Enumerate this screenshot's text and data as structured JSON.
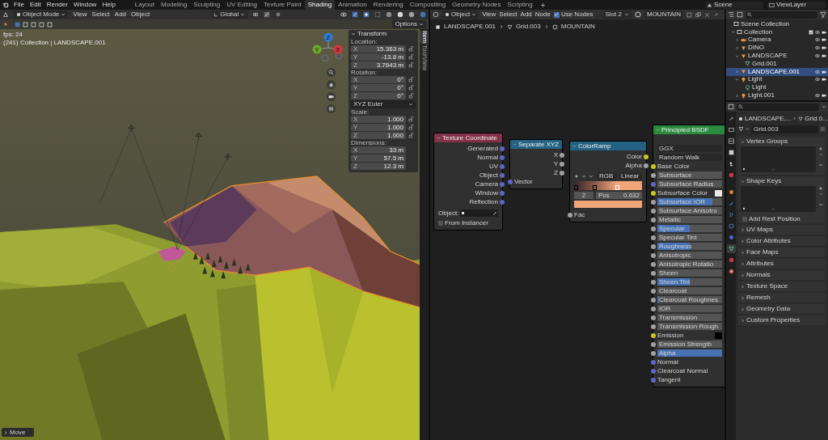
{
  "topbar": {
    "menus": [
      "File",
      "Edit",
      "Render",
      "Window",
      "Help"
    ],
    "workspaces": [
      {
        "label": "Layout",
        "selected": false
      },
      {
        "label": "Modeling",
        "selected": false
      },
      {
        "label": "Sculpting",
        "selected": false
      },
      {
        "label": "UV Editing",
        "selected": false
      },
      {
        "label": "Texture Paint",
        "selected": false
      },
      {
        "label": "Shading",
        "selected": true
      },
      {
        "label": "Animation",
        "selected": false
      },
      {
        "label": "Rendering",
        "selected": false
      },
      {
        "label": "Compositing",
        "selected": false
      },
      {
        "label": "Geometry Nodes",
        "selected": false
      },
      {
        "label": "Scripting",
        "selected": false
      }
    ],
    "scene": "Scene",
    "view_layer": "ViewLayer"
  },
  "viewport": {
    "header": {
      "mode": "Object Mode",
      "menus": [
        "View",
        "Select",
        "Add",
        "Object"
      ],
      "orientation": "Global"
    },
    "options": "Options",
    "stats": [
      "fps: 24",
      "(241) Collection | LANDSCAPE.001"
    ],
    "gizmo": [
      {
        "label": "Z",
        "color": "#2f7dd8"
      },
      {
        "label": "Y",
        "color": "#6fa82a"
      },
      {
        "label": "X",
        "color": "#d8343f"
      }
    ],
    "transform": {
      "title": "Transform",
      "groups": [
        {
          "label": "Location:",
          "lockable": true,
          "fields": [
            {
              "axis": "X",
              "value": "15.363 m"
            },
            {
              "axis": "Y",
              "value": "-13.8 m"
            },
            {
              "axis": "Z",
              "value": "3.7643 m"
            }
          ]
        },
        {
          "label": "Rotation:",
          "lockable": true,
          "fields": [
            {
              "axis": "X",
              "value": "0°"
            },
            {
              "axis": "Y",
              "value": "0°"
            },
            {
              "axis": "Z",
              "value": "0°"
            }
          ],
          "mode": "XYZ Euler"
        },
        {
          "label": "Scale:",
          "lockable": true,
          "fields": [
            {
              "axis": "X",
              "value": "1.000"
            },
            {
              "axis": "Y",
              "value": "1.000"
            },
            {
              "axis": "Z",
              "value": "1.000"
            }
          ]
        },
        {
          "label": "Dimensions:",
          "lockable": false,
          "fields": [
            {
              "axis": "X",
              "value": "33 m"
            },
            {
              "axis": "Y",
              "value": "57.5 m"
            },
            {
              "axis": "Z",
              "value": "12.3 m"
            }
          ]
        }
      ]
    },
    "sidebar_tabs": [
      {
        "label": "Item",
        "selected": true
      },
      {
        "label": "Tool",
        "selected": false
      },
      {
        "label": "View",
        "selected": false
      }
    ],
    "last_operator": "Move"
  },
  "node_editor": {
    "header": {
      "context": "Object",
      "menus": [
        "View",
        "Select",
        "Add",
        "Node"
      ],
      "use_nodes": {
        "label": "Use Nodes",
        "checked": true
      },
      "slot": "Slot 2",
      "material": "MOUNTAIN"
    },
    "breadcrumb": [
      "LANDSCAPE.001",
      "Grid.003",
      "MOUNTAIN"
    ],
    "nodes": [
      {
        "kind": "input",
        "title": "Texture Coordinate",
        "rows": [
          {
            "kind": "output",
            "label": "Generated",
            "socket": {
              "color": "#6363c7"
            }
          },
          {
            "kind": "output",
            "label": "Normal",
            "socket": {
              "color": "#6363c7"
            }
          },
          {
            "kind": "output",
            "label": "UV",
            "socket": {
              "color": "#6363c7"
            }
          },
          {
            "kind": "output",
            "label": "Object",
            "socket": {
              "color": "#6363c7"
            }
          },
          {
            "kind": "output",
            "label": "Camera",
            "socket": {
              "color": "#6363c7"
            }
          },
          {
            "kind": "output",
            "label": "Window",
            "socket": {
              "color": "#6363c7"
            }
          },
          {
            "kind": "output",
            "label": "Reflection",
            "socket": {
              "color": "#6363c7"
            }
          },
          {
            "kind": "object_field",
            "label": "Object:"
          },
          {
            "kind": "checkbox",
            "label": "From Instancer",
            "checked": false
          }
        ]
      },
      {
        "kind": "converter",
        "title": "Separate XYZ",
        "rows": [
          {
            "kind": "output",
            "label": "X",
            "socket": {
              "color": "#a1a1a1"
            }
          },
          {
            "kind": "output",
            "label": "Y",
            "socket": {
              "color": "#a1a1a1"
            }
          },
          {
            "kind": "output",
            "label": "Z",
            "socket": {
              "color": "#a1a1a1"
            }
          },
          {
            "kind": "input",
            "label": "Vector",
            "socket": {
              "color": "#6363c7"
            }
          }
        ]
      },
      {
        "kind": "converter",
        "title": "ColorRamp",
        "rows": [
          {
            "kind": "output",
            "label": "Color",
            "socket": {
              "color": "#c7c729"
            }
          },
          {
            "kind": "output",
            "label": "Alpha",
            "socket": {
              "color": "#a1a1a1"
            }
          },
          {
            "kind": "ramp",
            "color_mode": "RGB",
            "interpolation": "Linear",
            "stops": [
              {
                "level": 0.03,
                "color": "#3d2a2c",
                "selected": false
              },
              {
                "level": 0.3,
                "color": "#8c5a4a",
                "selected": false
              },
              {
                "level": 0.632,
                "color": "#f0a679",
                "selected": true
              }
            ],
            "index": "2",
            "pos_label": "Pos",
            "pos_value": "0.632",
            "color": "#f0a679"
          },
          {
            "kind": "input",
            "label": "Fac",
            "socket": {
              "color": "#a1a1a1"
            }
          }
        ]
      },
      {
        "kind": "shader",
        "title": "Principled BSDF",
        "rows": [
          {
            "kind": "dropdown",
            "label": "GGX"
          },
          {
            "kind": "dropdown",
            "label": "Random Walk"
          },
          {
            "kind": "input",
            "label": "Base Color",
            "socket": {
              "color": "#c7c729"
            }
          },
          {
            "kind": "slider",
            "label": "Subsurface",
            "socket": {
              "color": "#a1a1a1"
            },
            "level": 0
          },
          {
            "kind": "slider",
            "label": "Subsurface Radius",
            "socket": {
              "color": "#6363c7"
            },
            "level": 0
          },
          {
            "kind": "color_input",
            "label": "Subsurface Color",
            "socket": {
              "color": "#c7c729"
            },
            "color": "#e8e8e8"
          },
          {
            "kind": "slider",
            "label": "Subsurface IOR",
            "socket": {
              "color": "#a1a1a1"
            },
            "level": 0.85
          },
          {
            "kind": "slider",
            "label": "Subsurface Anisotro",
            "socket": {
              "color": "#a1a1a1"
            },
            "level": 0
          },
          {
            "kind": "slider",
            "label": "Metallic",
            "socket": {
              "color": "#a1a1a1"
            },
            "level": 0
          },
          {
            "kind": "slider",
            "label": "Specular",
            "socket": {
              "color": "#a1a1a1"
            },
            "level": 0.5
          },
          {
            "kind": "slider",
            "label": "Specular Tint",
            "socket": {
              "color": "#a1a1a1"
            },
            "level": 0
          },
          {
            "kind": "slider",
            "label": "Roughness",
            "socket": {
              "color": "#a1a1a1"
            },
            "level": 0.5
          },
          {
            "kind": "slider",
            "label": "Anisotropic",
            "socket": {
              "color": "#a1a1a1"
            },
            "level": 0
          },
          {
            "kind": "slider",
            "label": "Anisotropic Rotatio",
            "socket": {
              "color": "#a1a1a1"
            },
            "level": 0
          },
          {
            "kind": "slider",
            "label": "Sheen",
            "socket": {
              "color": "#a1a1a1"
            },
            "level": 0
          },
          {
            "kind": "slider",
            "label": "Sheen Tint",
            "socket": {
              "color": "#a1a1a1"
            },
            "level": 0.5
          },
          {
            "kind": "slider",
            "label": "Clearcoat",
            "socket": {
              "color": "#a1a1a1"
            },
            "level": 0
          },
          {
            "kind": "slider",
            "label": "Clearcoat Roughnes",
            "socket": {
              "color": "#a1a1a1"
            },
            "level": 0.03
          },
          {
            "kind": "slider",
            "label": "IOR",
            "socket": {
              "color": "#a1a1a1"
            },
            "level": 0
          },
          {
            "kind": "slider",
            "label": "Transmission",
            "socket": {
              "color": "#a1a1a1"
            },
            "level": 0
          },
          {
            "kind": "slider",
            "label": "Transmission Rough",
            "socket": {
              "color": "#a1a1a1"
            },
            "level": 0
          },
          {
            "kind": "color_input",
            "label": "Emission",
            "socket": {
              "color": "#c7c729"
            },
            "color": "#000000"
          },
          {
            "kind": "slider",
            "label": "Emission Strength",
            "socket": {
              "color": "#a1a1a1"
            },
            "level": 0
          },
          {
            "kind": "slider",
            "label": "Alpha",
            "socket": {
              "color": "#a1a1a1"
            },
            "level": 1
          },
          {
            "kind": "input",
            "label": "Normal",
            "socket": {
              "color": "#6363c7"
            }
          },
          {
            "kind": "input",
            "label": "Clearcoat Normal",
            "socket": {
              "color": "#6363c7"
            }
          },
          {
            "kind": "input",
            "label": "Tangent",
            "socket": {
              "color": "#6363c7"
            }
          }
        ]
      }
    ]
  },
  "outliner": {
    "tree": [
      {
        "label": "Scene Collection",
        "kind": "scene_collection",
        "selected": false,
        "children": [
          {
            "label": "Collection",
            "kind": "collection",
            "selected": false,
            "expanded": true,
            "children": [
              {
                "label": "Camera",
                "kind": "camera",
                "selected": false,
                "expanded": false
              },
              {
                "label": "DINO",
                "kind": "object",
                "selected": false,
                "expanded": false
              },
              {
                "label": "LANDSCAPE",
                "kind": "object",
                "selected": false,
                "expanded": true,
                "children": [
                  {
                    "label": "Grid.001",
                    "kind": "mesh",
                    "selected": false
                  }
                ]
              },
              {
                "label": "LANDSCAPE.001",
                "kind": "object",
                "selected": true,
                "expanded": false
              },
              {
                "label": "Light",
                "kind": "light",
                "selected": false,
                "expanded": true,
                "children": [
                  {
                    "label": "Light",
                    "kind": "light_data",
                    "selected": false
                  }
                ]
              },
              {
                "label": "Light.001",
                "kind": "light",
                "selected": false,
                "expanded": false
              }
            ]
          }
        ]
      }
    ]
  },
  "properties": {
    "tabs": [
      {
        "kind": "tool",
        "selected": false
      },
      {
        "kind": "render",
        "selected": false
      },
      {
        "kind": "output",
        "selected": false
      },
      {
        "kind": "view_layer",
        "selected": false
      },
      {
        "kind": "scene",
        "selected": false
      },
      {
        "kind": "world",
        "selected": false
      },
      {
        "kind": "object",
        "selected": false
      },
      {
        "kind": "modifiers",
        "selected": false
      },
      {
        "kind": "particles",
        "selected": false
      },
      {
        "kind": "physics",
        "selected": false
      },
      {
        "kind": "constraints",
        "selected": false
      },
      {
        "kind": "data",
        "selected": true
      },
      {
        "kind": "material",
        "selected": false
      },
      {
        "kind": "texture",
        "selected": false
      }
    ],
    "breadcrumb": [
      "LANDSCAPE....",
      "Grid.0..."
    ],
    "data_name": "Grid.003",
    "panels": [
      {
        "title": "Vertex Groups",
        "expanded": true
      },
      {
        "title": "Shape Keys",
        "expanded": true,
        "option": {
          "label": "Add Rest Position",
          "checked": false
        }
      },
      {
        "title": "UV Maps",
        "expanded": false
      },
      {
        "title": "Color Attributes",
        "expanded": false
      },
      {
        "title": "Face Maps",
        "expanded": false
      },
      {
        "title": "Attributes",
        "expanded": false
      },
      {
        "title": "Normals",
        "expanded": false
      },
      {
        "title": "Texture Space",
        "expanded": false
      },
      {
        "title": "Remesh",
        "expanded": false
      },
      {
        "title": "Geometry Data",
        "expanded": false
      },
      {
        "title": "Custom Properties",
        "expanded": false
      }
    ]
  }
}
